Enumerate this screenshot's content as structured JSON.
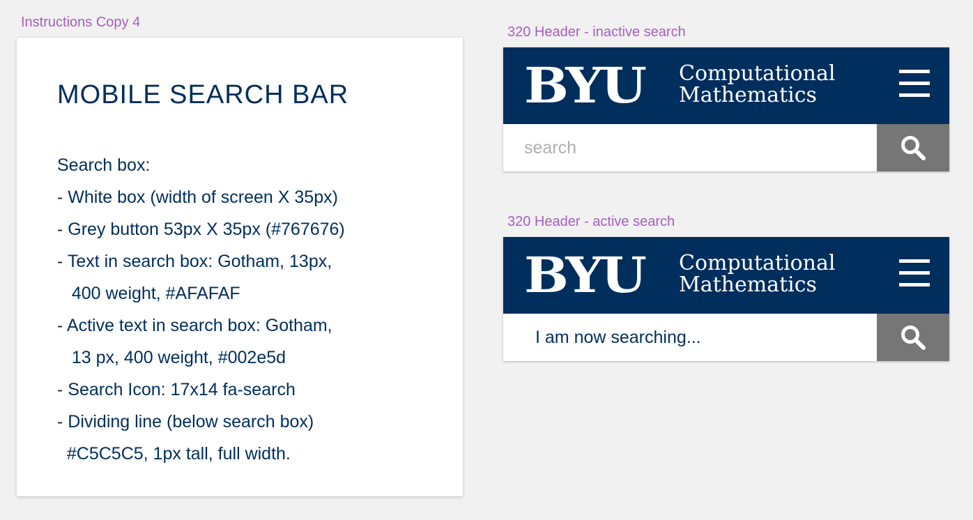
{
  "artboards": {
    "instructions_label": "Instructions Copy 4",
    "inactive_label": "320 Header - inactive search",
    "active_label": "320 Header - active search"
  },
  "instructions": {
    "title": "MOBILE SEARCH BAR",
    "lines": [
      "Search box:",
      "- White box (width of screen X 35px)",
      "- Grey button 53px X 35px (#767676)",
      "- Text in search box: Gotham, 13px,",
      "   400 weight, #AFAFAF",
      "- Active text in search box: Gotham,",
      "   13 px, 400 weight, #002e5d",
      "- Search Icon: 17x14 fa-search",
      "- Dividing line (below search box)",
      "  #C5C5C5, 1px tall, full width."
    ]
  },
  "header": {
    "logo_text": "BYU",
    "site_title_line1": "Computational",
    "site_title_line2": "Mathematics",
    "menu_icon": "hamburger-icon",
    "search_icon": "search-icon"
  },
  "inactive_search": {
    "placeholder": "search",
    "value": ""
  },
  "active_search": {
    "placeholder": "search",
    "value": "I am now searching..."
  },
  "colors": {
    "navy": "#002e5d",
    "search_button": "#767676",
    "placeholder_text": "#AFAFAF",
    "active_text": "#002e5d",
    "label_purple": "#a65ec1",
    "canvas": "#f1f1f1"
  }
}
